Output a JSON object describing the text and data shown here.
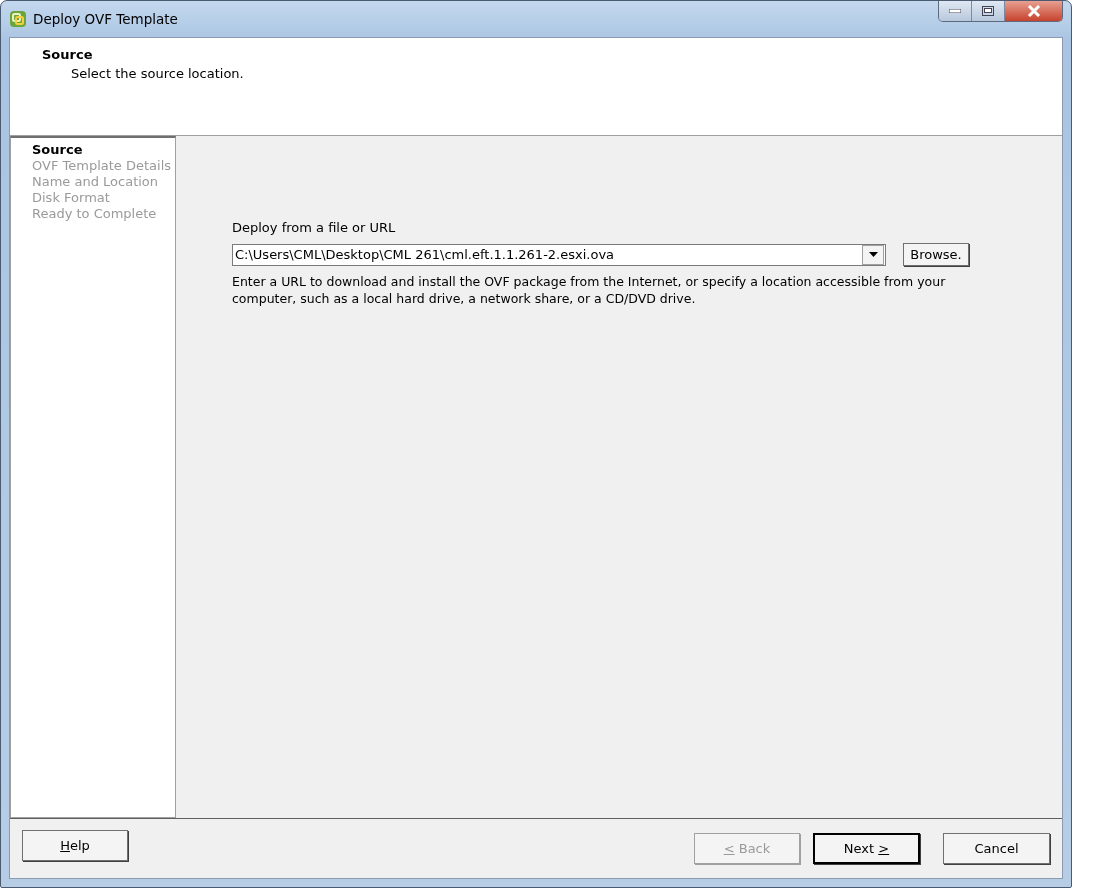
{
  "window": {
    "title": "Deploy OVF Template"
  },
  "header": {
    "title": "Source",
    "subtitle": "Select the source location."
  },
  "steps": [
    {
      "label": "Source",
      "selected": true
    },
    {
      "label": "OVF Template Details",
      "selected": false
    },
    {
      "label": "Name and Location",
      "selected": false
    },
    {
      "label": "Disk Format",
      "selected": false
    },
    {
      "label": "Ready to Complete",
      "selected": false
    }
  ],
  "source": {
    "label": "Deploy from a file or URL",
    "value": "C:\\Users\\CML\\Desktop\\CML 261\\cml.eft.1.1.261-2.esxi.ova",
    "browse": "Browse.",
    "hint": "Enter a URL to download and install the OVF package from the Internet, or specify a location accessible from your computer, such as a local hard drive, a network share, or a CD/DVD drive."
  },
  "buttons": [
    {
      "kind": "help",
      "key": "H",
      "after": "elp",
      "disabled": false,
      "default": false
    },
    {
      "kind": "back",
      "key": "<",
      "after": " Back",
      "disabled": true,
      "default": false
    },
    {
      "kind": "next",
      "before": "Next ",
      "key": ">",
      "disabled": false,
      "default": true
    },
    {
      "kind": "cancel",
      "before": "Cancel",
      "disabled": false,
      "default": false
    }
  ]
}
